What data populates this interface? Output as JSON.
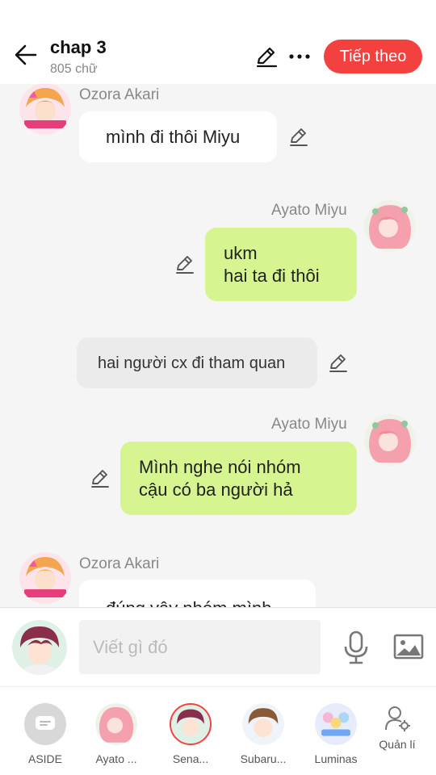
{
  "header": {
    "title": "chap 3",
    "word_count": "805 chữ",
    "next_label": "Tiếp theo"
  },
  "messages": [
    {
      "side": "left",
      "speaker": "Ozora Akari",
      "text": [
        "mình đi thôi Miyu"
      ]
    },
    {
      "side": "right",
      "speaker": "Ayato  Miyu",
      "text": [
        "ukm",
        "hai ta đi thôi"
      ]
    },
    {
      "side": "center",
      "speaker": "",
      "text": [
        "hai người cx đi tham quan"
      ]
    },
    {
      "side": "right",
      "speaker": "Ayato  Miyu",
      "text": [
        "Mình nghe nói nhóm",
        "cậu có ba người hả"
      ]
    },
    {
      "side": "left",
      "speaker": "Ozora Akari",
      "text": [
        "đúng vậy nhóm mình"
      ]
    }
  ],
  "input": {
    "placeholder": "Viết gì đó"
  },
  "characters": [
    {
      "label": "ASIDE"
    },
    {
      "label": "Ayato ..."
    },
    {
      "label": "Sena..."
    },
    {
      "label": "Subaru..."
    },
    {
      "label": "Luminas"
    },
    {
      "label": "Quản lí"
    }
  ],
  "colors": {
    "accent": "#f2413f",
    "my_bubble": "#d6f48f",
    "narration_bubble": "#ebebeb"
  }
}
